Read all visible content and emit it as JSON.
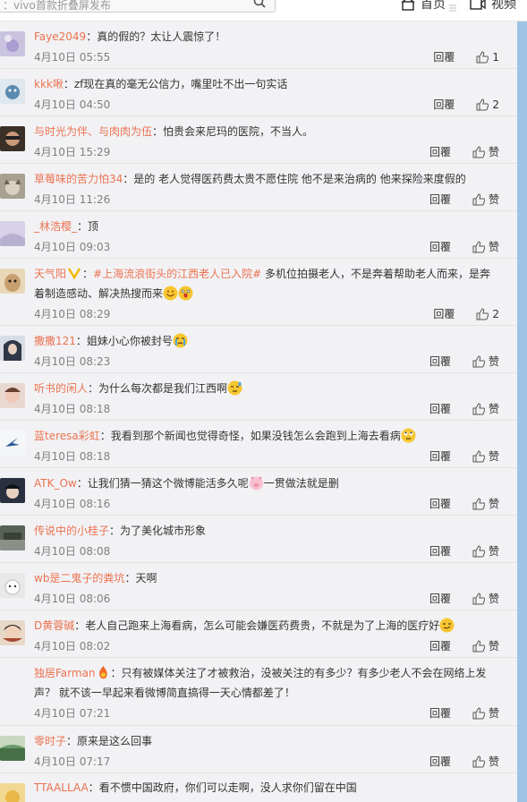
{
  "header": {
    "search_placeholder": "：vivo首款折叠屏发布",
    "home_label": "首页",
    "video_label": "视频"
  },
  "comments": [
    {
      "user": "Faye2049",
      "text": "真的假的？太让人震惊了！",
      "time": "4月10日 05:55",
      "reply": "回覆",
      "likes": "1",
      "avatar_color": "#b8b0d8"
    },
    {
      "user": "kkk啾",
      "text": "zf现在真的毫无公信力，嘴里吐不出一句实话",
      "time": "4月10日 04:50",
      "reply": "回覆",
      "likes": "2",
      "avatar_color": "#6fa8c8"
    },
    {
      "user": "与时光为伴、与肉肉为伍",
      "text": "怕贵会来尼玛的医院，不当人。",
      "time": "4月10日 15:29",
      "reply": "回覆",
      "likes": "",
      "avatar_color": "#5a4a3a"
    },
    {
      "user": "草莓味的苦力怕34",
      "text": "是的 老人觉得医药费太贵不愿住院 他不是来治病的 他来探险来度假的",
      "time": "4月10日 11:26",
      "reply": "回覆",
      "likes": "",
      "avatar_color": "#8a8070"
    },
    {
      "user": "_林浩樱_",
      "text": "顶",
      "time": "4月10日 09:03",
      "reply": "回覆",
      "likes": "",
      "avatar_color": "#c8c0d8"
    },
    {
      "user": "天气阳",
      "topic": "#上海流浪街头的江西老人已入院#",
      "text": "多机位拍摄老人，不是奔着帮助老人而来，是奔着制造感动、解决热搜而来",
      "time": "4月10日 08:29",
      "reply": "回覆",
      "likes": "2",
      "avatar_color": "#c8a878"
    },
    {
      "user": "撒撒121",
      "text": "姐妹小心你被封号",
      "time": "4月10日 08:23",
      "reply": "回覆",
      "likes": "",
      "avatar_color": "#404858"
    },
    {
      "user": "听书的闲人",
      "text": "为什么每次都是我们江西啊",
      "time": "4月10日 08:18",
      "reply": "回覆",
      "likes": "",
      "avatar_color": "#d8b8a8"
    },
    {
      "user": "蓝teresa彩虹",
      "text": "我看到那个新闻也觉得奇怪，如果没钱怎么会跑到上海去看病",
      "time": "4月10日 08:18",
      "reply": "回覆",
      "likes": "",
      "avatar_color": "#e8eef4"
    },
    {
      "user": "ATK_Ow",
      "text": "让我们猜一猜这个微博能活多久呢",
      "text2": "一贯做法就是删",
      "time": "4月10日 08:16",
      "reply": "回覆",
      "likes": "",
      "avatar_color": "#384050"
    },
    {
      "user": "传说中的小桂子",
      "text": "为了美化城市形象",
      "time": "4月10日 08:08",
      "reply": "回覆",
      "likes": "",
      "avatar_color": "#687068"
    },
    {
      "user": "wb是二鬼子的粪坑",
      "text": "天啊",
      "time": "4月10日 08:06",
      "reply": "回覆",
      "likes": "",
      "avatar_color": "#d0d0d0"
    },
    {
      "user": "D黄蓉碱",
      "text": "老人自己跑来上海看病，怎么可能会嫌医药费贵，不就是为了上海的医疗好",
      "time": "4月10日 08:02",
      "reply": "回覆",
      "likes": "",
      "avatar_color": "#a85838"
    },
    {
      "user": "独居Farman",
      "text": "只有被媒体关注了才被救治，没被关注的有多少？有多少老人不会在网络上发声？ 就不该一早起来看微博简直搞得一天心情都差了！",
      "time": "4月10日 07:21",
      "reply": "回覆",
      "likes": "",
      "avatar_color": "#f2f2f5"
    },
    {
      "user": "零时子",
      "text": "原来是这么回事",
      "time": "4月10日 07:17",
      "reply": "回覆",
      "likes": "",
      "avatar_color": "#587858"
    },
    {
      "user": "TTAALLAA",
      "text": "看不惯中国政府，你们可以走啊，没人求你们留在中国",
      "time": "",
      "reply": "",
      "likes": "",
      "avatar_color": "#e8c860"
    }
  ]
}
